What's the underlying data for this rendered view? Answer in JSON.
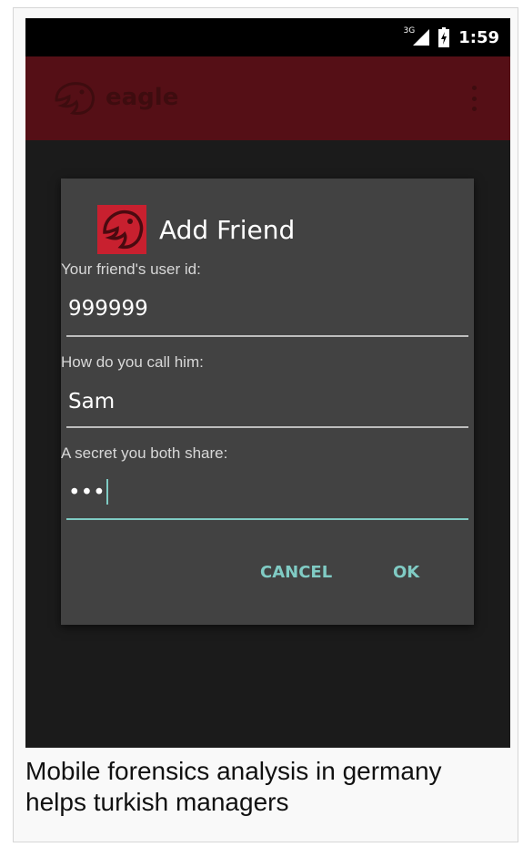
{
  "status_bar": {
    "network": "3G",
    "time": "1:59"
  },
  "app_bar": {
    "title": "eagle",
    "logo_icon": "eagle-logo-icon",
    "menu_icon": "overflow-menu-icon"
  },
  "dialog": {
    "title": "Add Friend",
    "icon": "eagle-logo-icon",
    "fields": [
      {
        "label": "Your friend's user id:",
        "value": "999999"
      },
      {
        "label": "How do you call him:",
        "value": "Sam"
      },
      {
        "label": "A secret you both share:",
        "value": "•••"
      }
    ],
    "cancel_label": "CANCEL",
    "ok_label": "OK"
  },
  "caption": "Mobile forensics analysis in germany helps turkish managers",
  "colors": {
    "app_bar": "#550f16",
    "accent": "#80cbc4",
    "dialog_bg": "#424242",
    "logo_red": "#c8202f"
  }
}
